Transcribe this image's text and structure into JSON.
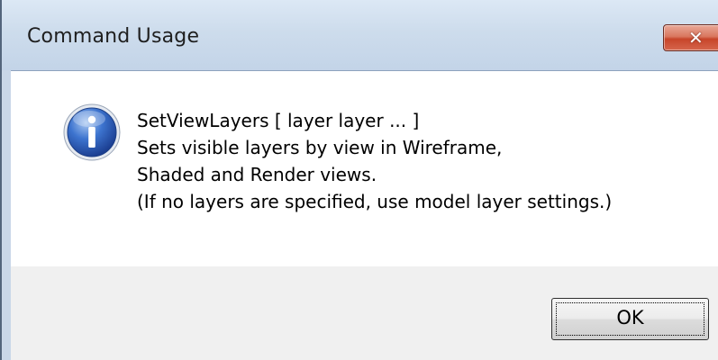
{
  "dialog": {
    "title": "Command Usage",
    "close_glyph": "✕",
    "icon": "info-icon",
    "message_lines": [
      "SetViewLayers [ layer layer ... ]",
      "Sets visible layers by view in Wireframe,",
      "Shaded and Render views.",
      " (If no layers are specified, use model layer settings.)"
    ],
    "ok_label": "OK"
  },
  "colors": {
    "titlebar": "#cddcec",
    "close_button": "#c7452a",
    "info_icon": "#2c5db8",
    "footer": "#f0f0f0"
  }
}
